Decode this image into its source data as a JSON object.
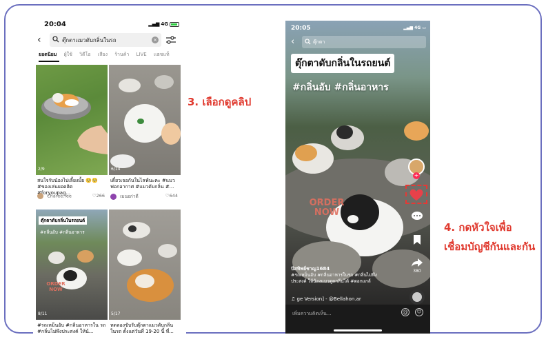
{
  "colors": {
    "frame_border": "#6b6fbf",
    "annotation_red": "#e03a2f",
    "tiktok_red": "#fe2c55"
  },
  "annotations": {
    "step3": "3. เลือกดูคลิป",
    "step4_line1": "4. กดหัวใจเพื่อ",
    "step4_line2": "เชื่อมบัญชีกันและกัน"
  },
  "left_phone": {
    "status": {
      "time": "20:04",
      "network": "4G"
    },
    "search": {
      "query": "ตุ๊กตาแมวดับกลิ่นในรถ",
      "back_icon": "chevron-left-icon",
      "filter_icon": "sliders-icon"
    },
    "tabs": [
      {
        "label": "ยอดนิยม",
        "active": true
      },
      {
        "label": "ผู้ใช้"
      },
      {
        "label": "วิดีโอ"
      },
      {
        "label": "เสียง"
      },
      {
        "label": "ร้านค้า"
      },
      {
        "label": "LIVE"
      },
      {
        "label": "แฮชแท็"
      }
    ],
    "results": [
      {
        "count": "2/9",
        "caption": "สนใจรับน้องไปเลี้ยงมั้ย 🥺🥺 #ของเล่นยอดฮิต #foryoupag...",
        "user": "Charee.ree",
        "likes": "266"
      },
      {
        "count": "6/14",
        "caption": "เดี๋ยวเจอกันในไลฟ์นะคะ #แมวฟอกอากาศ #แมวดับกลิ่น #...",
        "user": "เมนอก่าดี",
        "likes": "644"
      },
      {
        "count": "8/11",
        "caption": "#รถเหม็นอับ #กลิ่นอาหารใน รถ #กลิ่นไม่พึงประสงค์ ให้น้...",
        "overlay_title": "ตุ๊กตาดับกลิ่นในรถยนต์",
        "overlay_tags": "#กลิ่นอับ  #กลิ่นอาหาร",
        "overlay_order": "ORDER NOW"
      },
      {
        "count": "5/17",
        "caption": "ทดลองขับรับตุ๊กตาแมวดับกลิ่น ในรถ ตั้งแต่วันที่ 19-20 นี้ ที่..."
      }
    ]
  },
  "right_phone": {
    "status": {
      "time": "20:05",
      "network": "4G"
    },
    "search": {
      "query": "ตุ๊กตา"
    },
    "title_label": "ตุ๊กตาดับกลิ่นในรถยนต์",
    "hashtags": "#กลิ่นอับ  #กลิ่นอาหาร",
    "order_now": "ORDER NOW",
    "avatar_badge": "+",
    "share_count": "380",
    "caption": {
      "user": "ปัสทิพย์ชาญ1684",
      "line1": "#รถเหม็นอับ #กลิ่นอาหารในรถ #กลิ่นไม่พึง",
      "line2": "ประสงค์ ให้น้องแมวดูดกลิ่นได้ #ดอกแกล้"
    },
    "music": "♫ ge Version] - @Bellahon.ar",
    "comment_placeholder": "เพิ่มความคิดเห็น..."
  }
}
